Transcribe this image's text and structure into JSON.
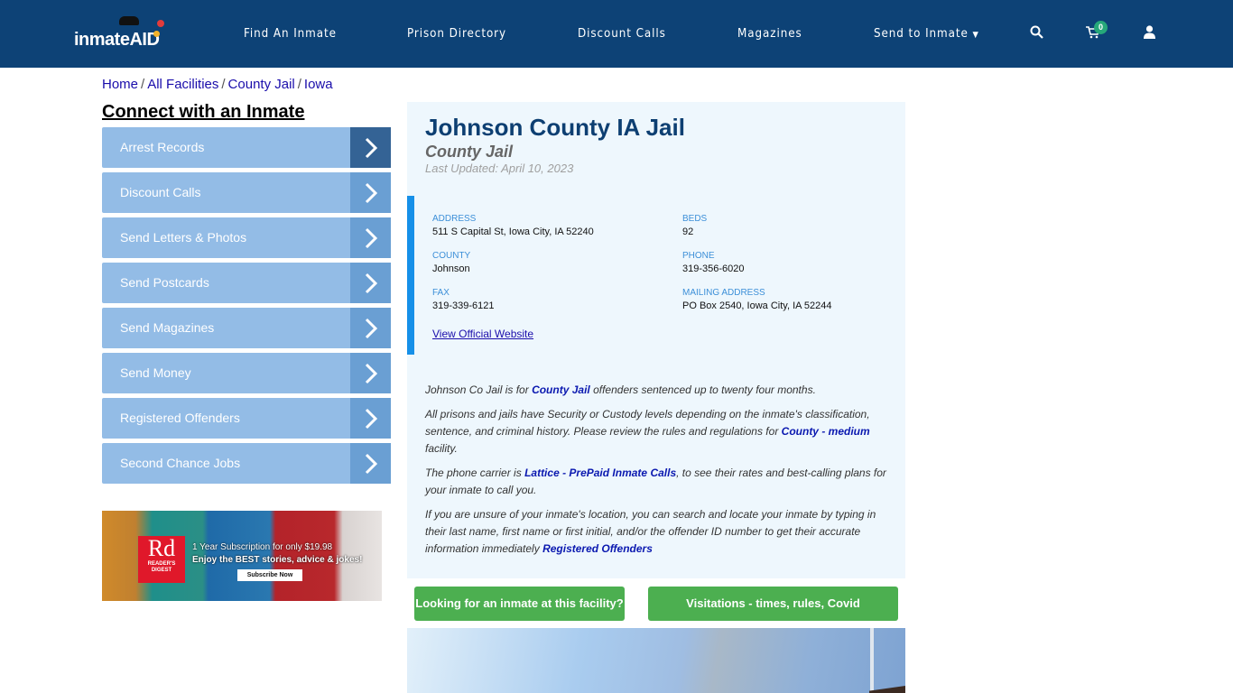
{
  "header": {
    "logo_text": "inmateAID",
    "nav": [
      {
        "label": "Find An Inmate"
      },
      {
        "label": "Prison Directory"
      },
      {
        "label": "Discount Calls"
      },
      {
        "label": "Magazines"
      },
      {
        "label": "Send to Inmate"
      }
    ],
    "cart_count": "0",
    "icons": [
      "search-icon",
      "cart-icon",
      "user-icon"
    ]
  },
  "breadcrumb": [
    "Home",
    "All Facilities",
    "County Jail",
    "Iowa"
  ],
  "sidebar": {
    "title": "Connect with an Inmate",
    "items": [
      {
        "label": "Arrest Records"
      },
      {
        "label": "Discount Calls"
      },
      {
        "label": "Send Letters & Photos"
      },
      {
        "label": "Send Postcards"
      },
      {
        "label": "Send Magazines"
      },
      {
        "label": "Send Money"
      },
      {
        "label": "Registered Offenders"
      },
      {
        "label": "Second Chance Jobs"
      }
    ],
    "ad": {
      "logo_big": "Rd",
      "logo_small1": "READER'S",
      "logo_small2": "DIGEST",
      "line1": "1 Year Subscription for only $19.98",
      "line2": "Enjoy the BEST stories, advice & jokes!",
      "button": "Subscribe Now"
    }
  },
  "facility": {
    "title": "Johnson County IA Jail",
    "type": "County Jail",
    "updated": "Last Updated: April 10, 2023",
    "fields": {
      "address": {
        "label": "ADDRESS",
        "value": "511 S Capital St, Iowa City, IA 52240"
      },
      "beds": {
        "label": "BEDS",
        "value": "92"
      },
      "county": {
        "label": "COUNTY",
        "value": "Johnson"
      },
      "phone": {
        "label": "PHONE",
        "value": "319-356-6020"
      },
      "fax": {
        "label": "FAX",
        "value": "319-339-6121"
      },
      "mailing": {
        "label": "MAILING ADDRESS",
        "value": "PO Box 2540, Iowa City, IA 52244"
      }
    },
    "website_link": "View Official Website",
    "desc": {
      "p1_a": "Johnson Co Jail is for ",
      "p1_link": "County Jail",
      "p1_b": " offenders sentenced up to twenty four months.",
      "p2_a": "All prisons and jails have Security or Custody levels depending on the inmate's classification, sentence, and criminal history. Please review the rules and regulations for ",
      "p2_link": "County - medium",
      "p2_b": " facility.",
      "p3_a": "The phone carrier is ",
      "p3_link": "Lattice - PrePaid Inmate Calls",
      "p3_b": ", to see their rates and best-calling plans for your inmate to call you.",
      "p4_a": "If you are unsure of your inmate's location, you can search and locate your inmate by typing in their last name, first name or first initial, and/or the offender ID number to get their accurate information immediately ",
      "p4_link": "Registered Offenders"
    },
    "buttons": {
      "find_inmate": "Looking for an inmate at this facility?",
      "visitations": "Visitations - times, rules, Covid cancellations"
    }
  },
  "colors": {
    "navbar": "#0d4276",
    "sidebar_item": "#93bce6",
    "accent_green": "#4caf50",
    "title_blue": "#0d3f72"
  }
}
